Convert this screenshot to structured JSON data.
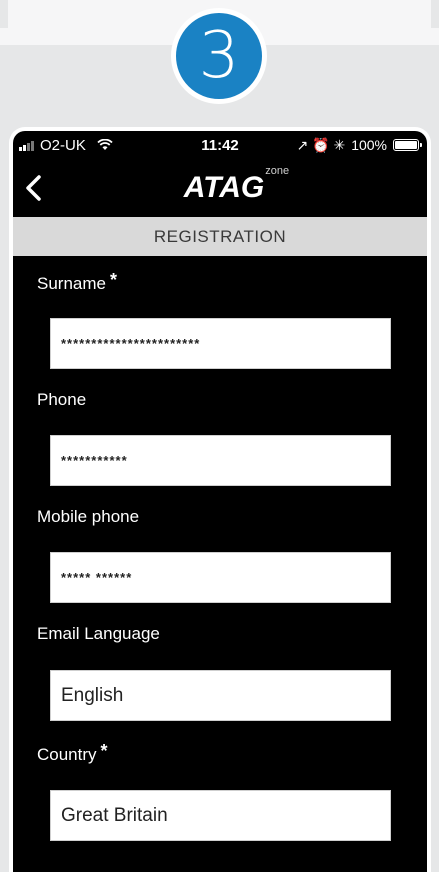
{
  "step": {
    "number": "3",
    "color": "#1a82c4"
  },
  "status_bar": {
    "carrier": "O2-UK",
    "time": "11:42",
    "right_icons": "↗ ⏰ ✳",
    "battery": "100%"
  },
  "nav": {
    "back_icon": "chevron-left-icon",
    "logo": "ATAG",
    "logo_sup": "zone"
  },
  "section": {
    "title": "REGISTRATION"
  },
  "fields": [
    {
      "label": "Surname",
      "required_mark": "*",
      "value": "***********************"
    },
    {
      "label": "Phone",
      "required_mark": "",
      "value": "***********"
    },
    {
      "label": "Mobile phone",
      "required_mark": "",
      "value": "***** ******"
    },
    {
      "label": "Email Language",
      "required_mark": "",
      "value": "English"
    },
    {
      "label": "Country",
      "required_mark": "*",
      "value": "Great Britain"
    }
  ]
}
